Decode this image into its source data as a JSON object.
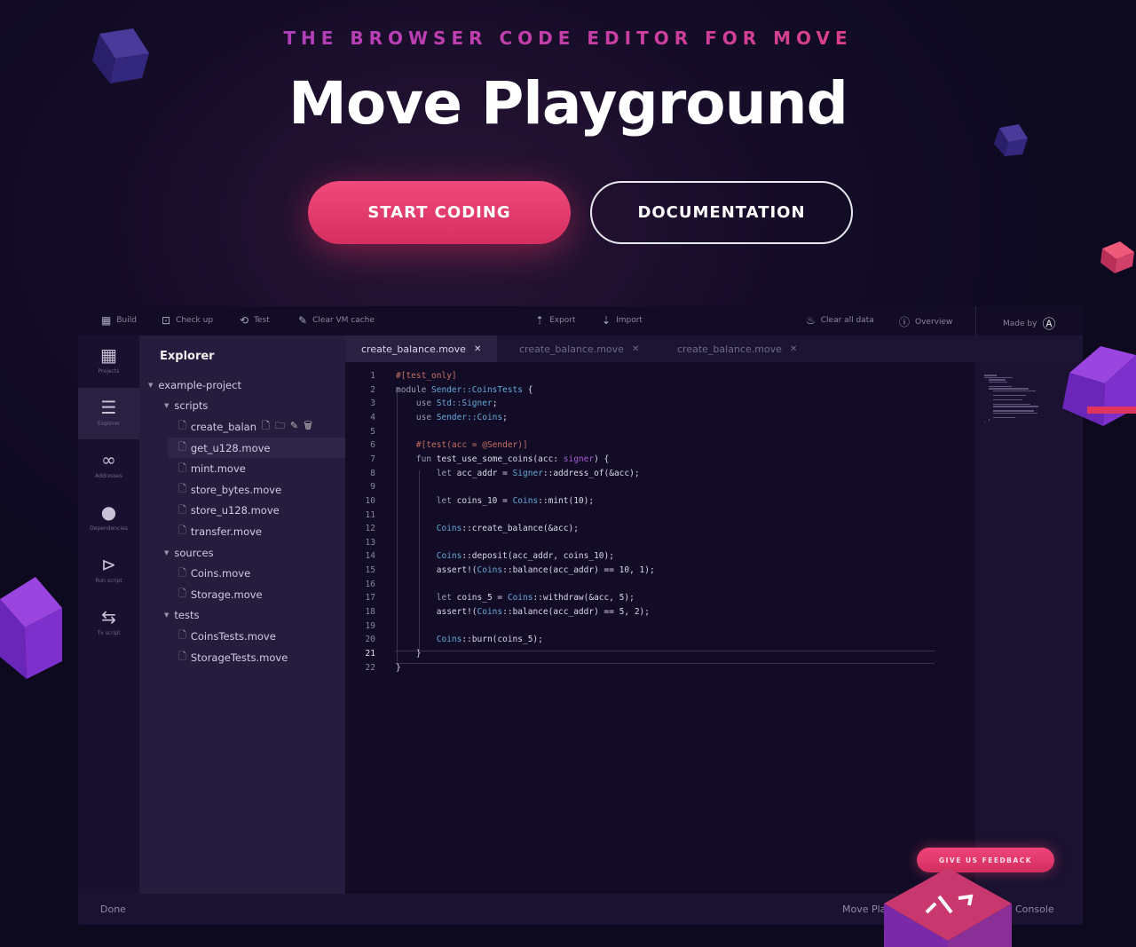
{
  "hero": {
    "tagline": "THE BROWSER CODE EDITOR FOR MOVE",
    "title": "Move Playground",
    "start_label": "START CODING",
    "docs_label": "DOCUMENTATION"
  },
  "toolbar": {
    "build": "Build",
    "checkup": "Check up",
    "test": "Test",
    "clear_vm": "Clear VM cache",
    "export": "Export",
    "import": "Import",
    "clear_all": "Clear all data",
    "overview": "Overview",
    "made_by": "Made by"
  },
  "iconbar": [
    {
      "label": "Projects",
      "icon": "grid-icon"
    },
    {
      "label": "Explorer",
      "icon": "list-icon"
    },
    {
      "label": "Addresses",
      "icon": "link-icon"
    },
    {
      "label": "Dependencies",
      "icon": "github-icon"
    },
    {
      "label": "Run script",
      "icon": "play-icon"
    },
    {
      "label": "Tx script",
      "icon": "transfer-icon"
    }
  ],
  "explorer": {
    "title": "Explorer",
    "tree": [
      {
        "label": "example-project",
        "type": "folder",
        "depth": 0
      },
      {
        "label": "scripts",
        "type": "folder",
        "depth": 1
      },
      {
        "label": "create_balan",
        "type": "file",
        "depth": 2,
        "hover": true
      },
      {
        "label": "get_u128.move",
        "type": "file",
        "depth": 2,
        "selected": true
      },
      {
        "label": "mint.move",
        "type": "file",
        "depth": 2
      },
      {
        "label": "store_bytes.move",
        "type": "file",
        "depth": 2
      },
      {
        "label": "store_u128.move",
        "type": "file",
        "depth": 2
      },
      {
        "label": "transfer.move",
        "type": "file",
        "depth": 2
      },
      {
        "label": "sources",
        "type": "folder",
        "depth": 1
      },
      {
        "label": "Coins.move",
        "type": "file",
        "depth": 2
      },
      {
        "label": "Storage.move",
        "type": "file",
        "depth": 2
      },
      {
        "label": "tests",
        "type": "folder",
        "depth": 1
      },
      {
        "label": "CoinsTests.move",
        "type": "file",
        "depth": 2
      },
      {
        "label": "StorageTests.move",
        "type": "file",
        "depth": 2
      }
    ]
  },
  "tabs": [
    {
      "label": "create_balance.move",
      "active": true
    },
    {
      "label": "create_balance.move"
    },
    {
      "label": "create_balance.move"
    }
  ],
  "code": {
    "current_line": 21,
    "lines": [
      [
        [
          "#[test_only]",
          "attr"
        ]
      ],
      [
        [
          "module ",
          "kw"
        ],
        [
          "Sender::CoinsTests",
          "type"
        ],
        [
          " {",
          "txt"
        ]
      ],
      [
        [
          "    use ",
          "kw"
        ],
        [
          "Std::Signer",
          "type"
        ],
        [
          ";",
          "txt"
        ]
      ],
      [
        [
          "    use ",
          "kw"
        ],
        [
          "Sender::Coins",
          "type"
        ],
        [
          ";",
          "txt"
        ]
      ],
      [],
      [
        [
          "    #[test(acc = @Sender)]",
          "attr"
        ]
      ],
      [
        [
          "    fun ",
          "kw"
        ],
        [
          "test_use_some_coins(acc: ",
          "txt"
        ],
        [
          "signer",
          "sig"
        ],
        [
          ") {",
          "txt"
        ]
      ],
      [
        [
          "        let ",
          "kw"
        ],
        [
          "acc_addr = ",
          "txt"
        ],
        [
          "Signer",
          "type"
        ],
        [
          "::address_of(&acc);",
          "txt"
        ]
      ],
      [],
      [
        [
          "        let ",
          "kw"
        ],
        [
          "coins_10 = ",
          "txt"
        ],
        [
          "Coins",
          "type"
        ],
        [
          "::mint(10);",
          "txt"
        ]
      ],
      [],
      [
        [
          "        Coins",
          "type"
        ],
        [
          "::create_balance(&acc);",
          "txt"
        ]
      ],
      [],
      [
        [
          "        Coins",
          "type"
        ],
        [
          "::deposit(acc_addr, coins_10);",
          "txt"
        ]
      ],
      [
        [
          "        assert!(",
          "txt"
        ],
        [
          "Coins",
          "type"
        ],
        [
          "::balance(acc_addr) == 10, 1);",
          "txt"
        ]
      ],
      [],
      [
        [
          "        let ",
          "kw"
        ],
        [
          "coins_5 = ",
          "txt"
        ],
        [
          "Coins",
          "type"
        ],
        [
          "::withdraw(&acc, 5);",
          "txt"
        ]
      ],
      [
        [
          "        assert!(",
          "txt"
        ],
        [
          "Coins",
          "type"
        ],
        [
          "::balance(acc_addr) == 5, 2);",
          "txt"
        ]
      ],
      [],
      [
        [
          "        Coins",
          "type"
        ],
        [
          "::burn(coins_5);",
          "txt"
        ]
      ],
      [
        [
          "    }",
          "txt"
        ]
      ],
      [
        [
          "}",
          "txt"
        ]
      ]
    ]
  },
  "status": {
    "left": "Done",
    "middle": "Move Pla",
    "right": "Console"
  },
  "feedback": {
    "label": "GIVE US FEEDBACK"
  },
  "colors": {
    "accent": "#e83a6c",
    "bg": "#130c26",
    "panel": "#261c3e"
  }
}
